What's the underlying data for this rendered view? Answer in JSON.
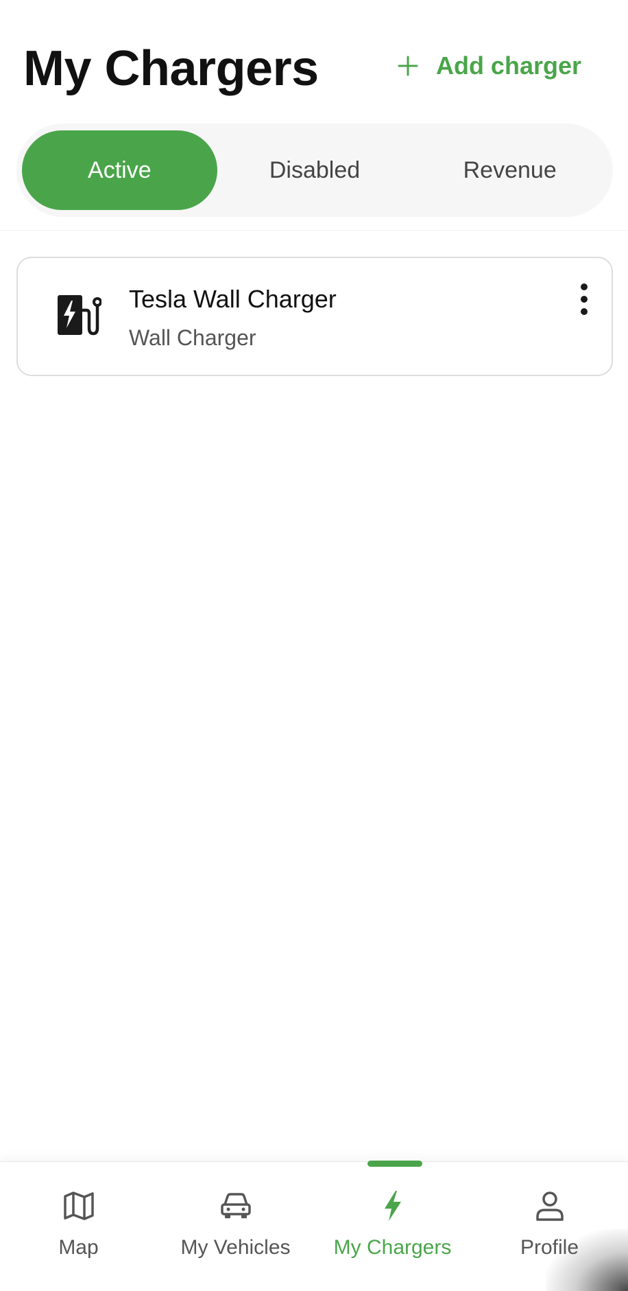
{
  "header": {
    "title": "My Chargers",
    "add_label": "Add charger"
  },
  "tabs": [
    {
      "label": "Active",
      "selected": true
    },
    {
      "label": "Disabled",
      "selected": false
    },
    {
      "label": "Revenue",
      "selected": false
    }
  ],
  "chargers": [
    {
      "name": "Tesla Wall Charger",
      "type": "Wall Charger",
      "icon": "ev-charger-icon"
    }
  ],
  "bottom_nav": [
    {
      "label": "Map",
      "icon": "map-icon",
      "selected": false
    },
    {
      "label": "My Vehicles",
      "icon": "car-icon",
      "selected": false
    },
    {
      "label": "My Chargers",
      "icon": "bolt-icon",
      "selected": true
    },
    {
      "label": "Profile",
      "icon": "person-icon",
      "selected": false
    }
  ],
  "colors": {
    "accent": "#4aa54a",
    "text": "#111111",
    "muted": "#555555",
    "tab_bg": "#f6f6f6"
  }
}
